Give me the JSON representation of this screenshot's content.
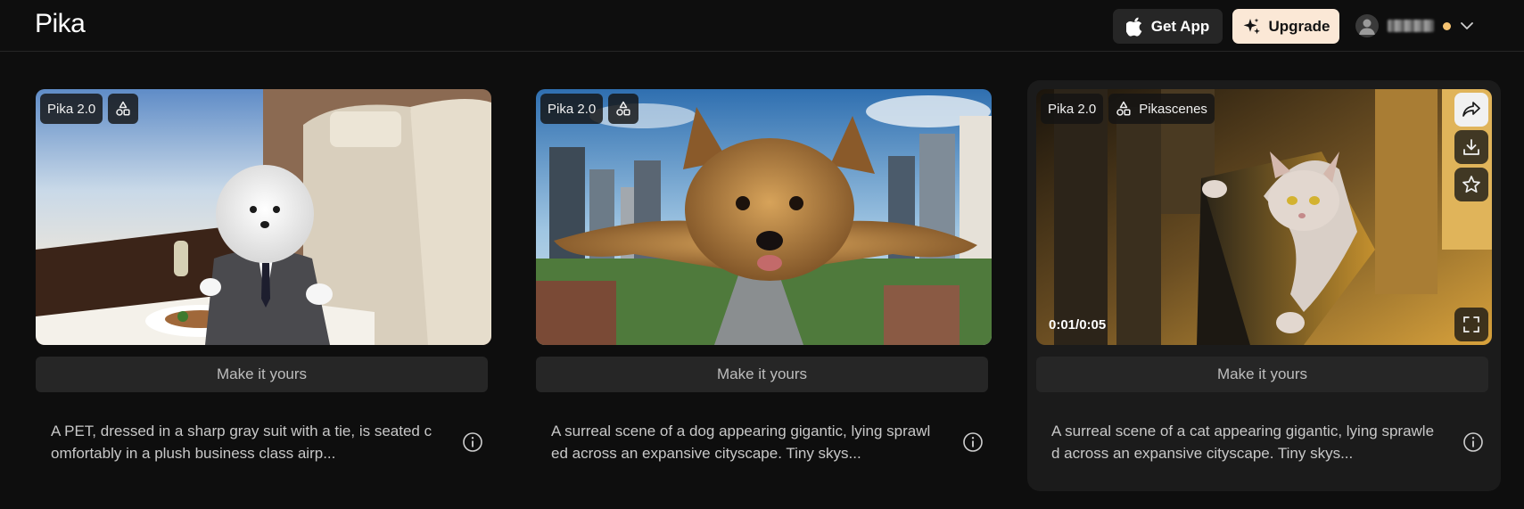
{
  "app": {
    "logo_text": "Pika",
    "get_app_label": "Get App",
    "upgrade_label": "Upgrade",
    "status_color": "#f5c371"
  },
  "cards": [
    {
      "model": "Pika 2.0",
      "scene_tag": "",
      "make_label": "Make it yours",
      "description": "A PET, dressed in a sharp gray suit with a tie, is seated comfortably in a plush business class airp...",
      "subject": "dog in suit on airplane"
    },
    {
      "model": "Pika 2.0",
      "scene_tag": "",
      "make_label": "Make it yours",
      "description": "A surreal scene of a dog appearing gigantic, lying sprawled across an expansive cityscape. Tiny skys...",
      "subject": "giant dog over city"
    },
    {
      "model": "Pika 2.0",
      "scene_tag": "Pikascenes",
      "make_label": "Make it yours",
      "description": "A surreal scene of a cat appearing gigantic, lying sprawled across an expansive cityscape. Tiny skys...",
      "subject": "giant cat on skyscraper",
      "timecode": "0:01/0:05"
    }
  ],
  "icons": {
    "apple": "apple-icon",
    "sparkle": "sparkle-icon",
    "user": "user-icon",
    "chevron": "chevron-down-icon",
    "shapes": "shapes-icon",
    "share": "share-icon",
    "download": "download-icon",
    "star": "star-icon",
    "fullscreen": "fullscreen-icon",
    "info": "info-icon"
  }
}
